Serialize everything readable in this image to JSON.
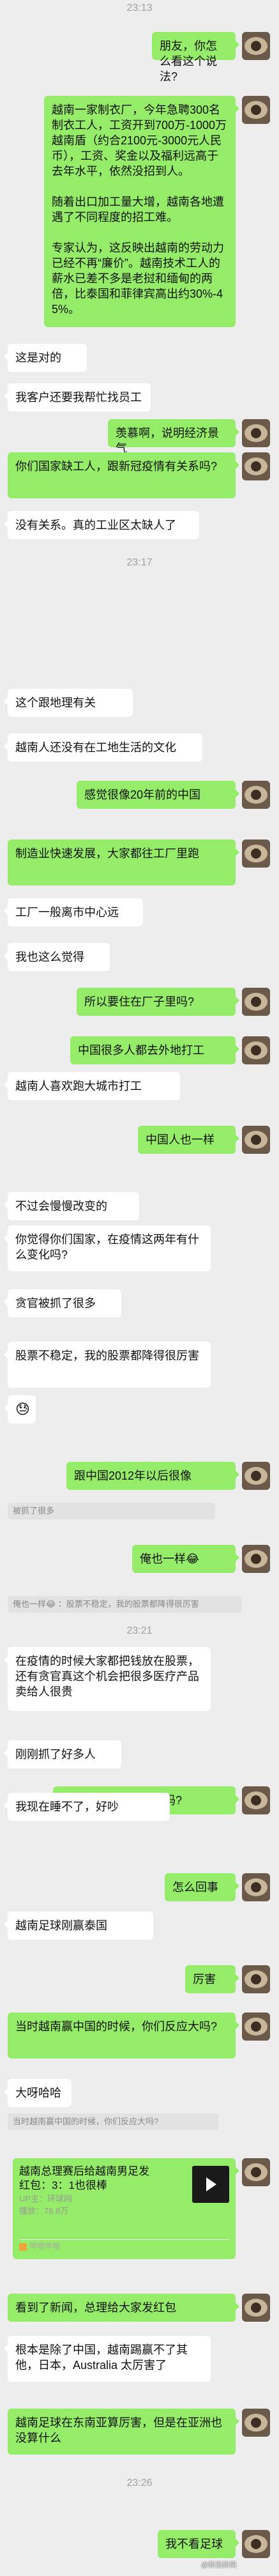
{
  "timestamps": [
    "23:13",
    "23:17",
    "23:21",
    "23:26"
  ],
  "messages": [
    {
      "side": "me",
      "text": "朋友，你怎么看这个说法?"
    },
    {
      "side": "me",
      "text": "越南一家制衣厂，今年急聘300名制衣工人，工资开到700万-1000万越南盾（约合2100元-3000元人民币），工资、奖金以及福利远高于去年水平，依然没招到人。\n\n随着出口加工量大增，越南各地遭遇了不同程度的招工难。\n\n专家认为，这反映出越南的劳动力已经不再“廉价”。越南技术工人的薪水已差不多是老挝和缅甸的两倍，比泰国和菲律宾高出约30%-45%。"
    },
    {
      "side": "them",
      "text": "这是对的"
    },
    {
      "side": "them",
      "text": "我客户还要我帮忙找员工"
    },
    {
      "side": "me",
      "text": "羡慕啊，说明经济景气"
    },
    {
      "side": "me",
      "text": "你们国家缺工人，跟新冠疫情有关系吗?"
    },
    {
      "side": "them",
      "text": "没有关系。真的工业区太缺人了"
    },
    {
      "side": "them",
      "text": "这个跟地理有关"
    },
    {
      "side": "them",
      "text": "越南人还没有在工地生活的文化"
    },
    {
      "side": "me",
      "text": "感觉很像20年前的中国"
    },
    {
      "side": "me",
      "text": "制造业快速发展，大家都往工厂里跑"
    },
    {
      "side": "them",
      "text": "工厂一般离市中心远"
    },
    {
      "side": "them",
      "text": "我也这么觉得"
    },
    {
      "side": "me",
      "text": "所以要住在厂子里吗?"
    },
    {
      "side": "me",
      "text": "中国很多人都去外地打工"
    },
    {
      "side": "them",
      "text": "越南人喜欢跑大城市打工"
    },
    {
      "side": "me",
      "text": "中国人也一样"
    },
    {
      "side": "them",
      "text": "不过会慢慢改变的"
    },
    {
      "side": "me",
      "text": "你觉得你们国家，在疫情这两年有什么变化吗?"
    },
    {
      "side": "them",
      "text": "贪官被抓了很多"
    },
    {
      "side": "them",
      "text": "股票不稳定，我的股票都降得很厉害"
    },
    {
      "side": "them",
      "text": "😓"
    },
    {
      "side": "me",
      "text": "跟中国2012年以后很像"
    },
    {
      "side": "me",
      "text": "俺也一样😂"
    },
    {
      "side": "them",
      "text": "在疫情的时候大家都把钱放在股票，还有贪官真这个机会把很多医疗产品卖给人很贵"
    },
    {
      "side": "them",
      "text": "刚刚抓了好多人"
    },
    {
      "side": "me",
      "text": "还有啥别的事情发生吗?"
    },
    {
      "side": "them",
      "text": "我现在睡不了，好吵"
    },
    {
      "side": "me",
      "text": "怎么回事"
    },
    {
      "side": "them",
      "text": "越南足球刚赢泰国"
    },
    {
      "side": "me",
      "text": "厉害"
    },
    {
      "side": "me",
      "text": "当时越南赢中国的时候，你们反应大吗?"
    },
    {
      "side": "them",
      "text": "大呀哈哈"
    },
    {
      "side": "me",
      "text": "看到了新闻，总理给大家发红包"
    },
    {
      "side": "them",
      "text": "根本是除了中国，越南踢赢不了其他，日本，Australia 太厉害了"
    },
    {
      "side": "me",
      "text": "越南足球在东南亚算厉害，但是在亚洲也没算什么"
    },
    {
      "side": "me",
      "text": "我不看足球"
    }
  ],
  "quotes": [
    "被抓了很多",
    "俺也一样😂 ：股票不稳定，我的股票都降得很厉害",
    "当时越南赢中国的时候，你们反应大吗?"
  ],
  "card": {
    "title": "越南总理赛后给越南男足发红包：3：1也很棒",
    "up": "UP主：环球网",
    "plays": "播放：76.8万",
    "source": "哔哩哔哩"
  },
  "watermark": "@新浪新闻"
}
